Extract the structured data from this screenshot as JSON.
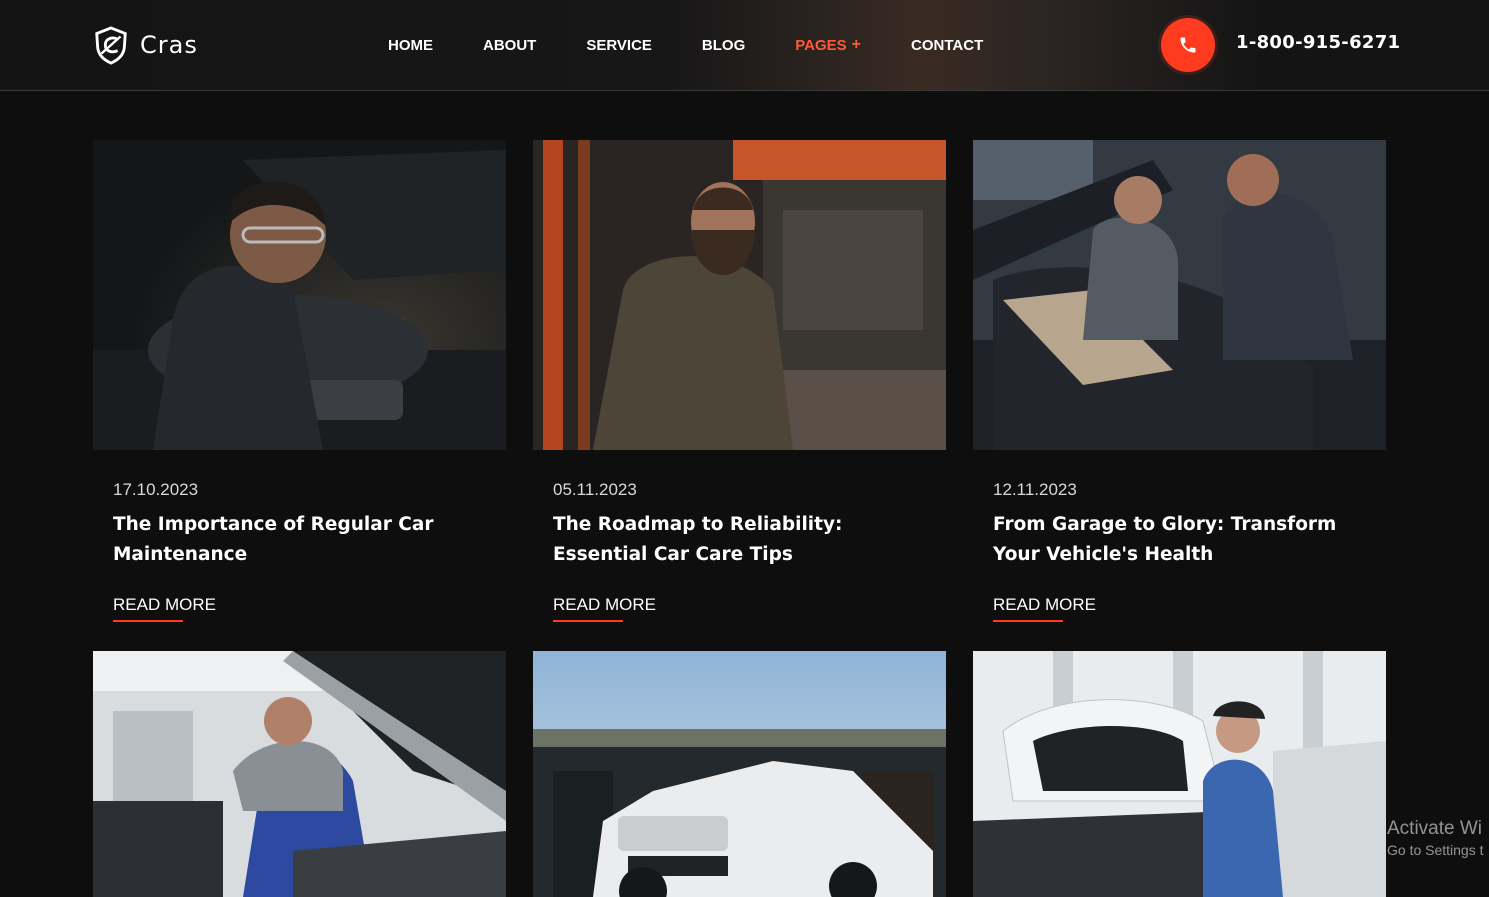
{
  "brand": {
    "name": "Cras"
  },
  "nav": {
    "items": [
      {
        "label": "HOME"
      },
      {
        "label": "ABOUT"
      },
      {
        "label": "SERVICE"
      },
      {
        "label": "BLOG"
      },
      {
        "label": "PAGES"
      },
      {
        "label": "CONTACT"
      }
    ],
    "pages_expand": "+"
  },
  "contact": {
    "phone": "1-800-915-6271"
  },
  "posts": [
    {
      "date": "17.10.2023",
      "title": "The Importance of Regular Car Maintenance",
      "link": "READ MORE"
    },
    {
      "date": "05.11.2023",
      "title": "The Roadmap to Reliability: Essential Car Care Tips",
      "link": "READ MORE"
    },
    {
      "date": "12.11.2023",
      "title": "From Garage to Glory: Transform Your Vehicle's Health",
      "link": "READ MORE"
    }
  ],
  "watermark": {
    "line1": "Activate Wi",
    "line2": "Go to Settings t"
  },
  "colors": {
    "accent": "#ff3b1f",
    "background": "#0e0e0e",
    "text": "#ffffff"
  }
}
